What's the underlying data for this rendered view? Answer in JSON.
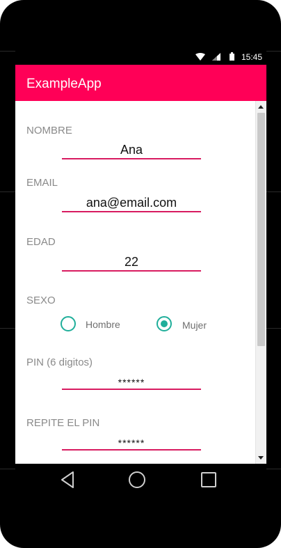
{
  "status_bar": {
    "time": "15:45",
    "icons": [
      "wifi-icon",
      "signal-icon",
      "battery-icon"
    ]
  },
  "app_bar": {
    "title": "ExampleApp",
    "color": "#ff0057"
  },
  "form": {
    "nombre": {
      "label": "NOMBRE",
      "value": "Ana"
    },
    "email": {
      "label": "EMAIL",
      "value": "ana@email.com"
    },
    "edad": {
      "label": "EDAD",
      "value": "22"
    },
    "sexo": {
      "label": "SEXO",
      "options": [
        {
          "label": "Hombre",
          "selected": false
        },
        {
          "label": "Mujer",
          "selected": true
        }
      ]
    },
    "pin": {
      "label": "PIN (6 digitos)",
      "value": "******"
    },
    "repite_pin": {
      "label": "REPITE EL PIN",
      "value": "******"
    }
  },
  "colors": {
    "underline": "#d81b60",
    "radio": "#1fae9a",
    "label": "#8a8a8a"
  },
  "nav_bar": {
    "buttons": [
      "back-icon",
      "home-icon",
      "recent-apps-icon"
    ]
  }
}
